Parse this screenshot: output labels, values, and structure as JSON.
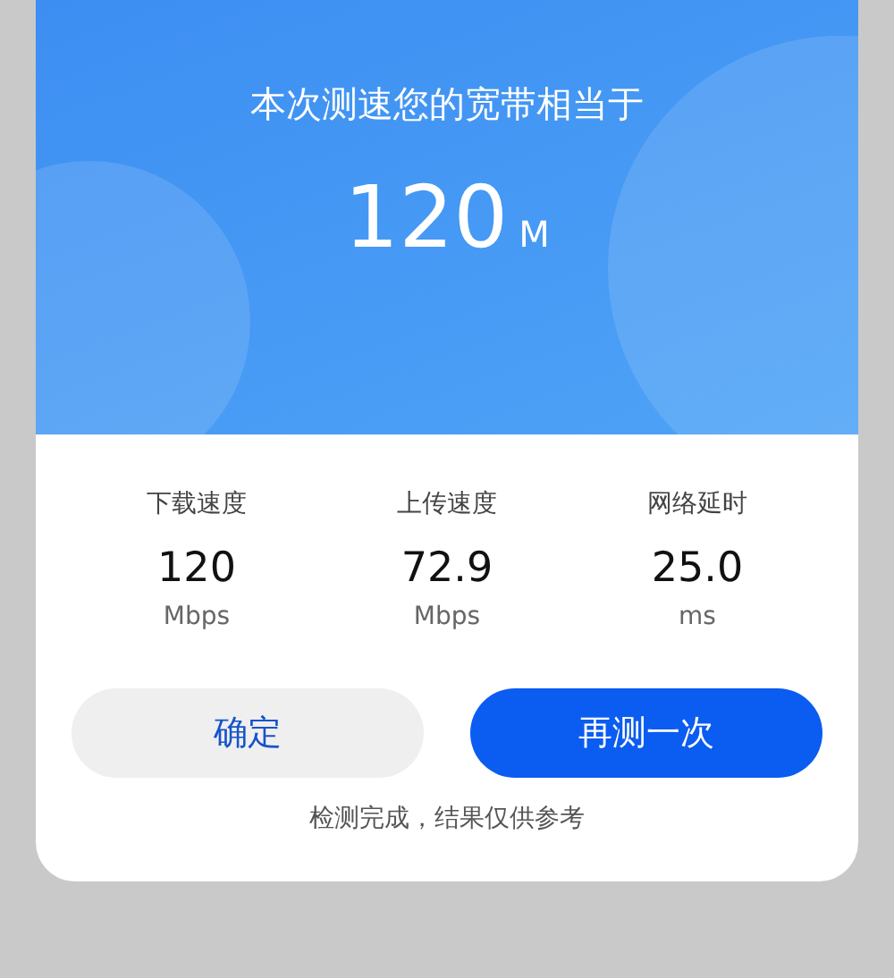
{
  "header": {
    "title": "本次测速您的宽带相当于",
    "speed": "120",
    "unit": "M"
  },
  "stats": [
    {
      "label": "下载速度",
      "value": "120",
      "unit": "Mbps"
    },
    {
      "label": "上传速度",
      "value": "72.9",
      "unit": "Mbps"
    },
    {
      "label": "网络延时",
      "value": "25.0",
      "unit": "ms"
    }
  ],
  "buttons": [
    {
      "label": "确定",
      "kind": "secondary"
    },
    {
      "label": "再测一次",
      "kind": "primary"
    }
  ],
  "footer": "检测完成，结果仅供参考"
}
